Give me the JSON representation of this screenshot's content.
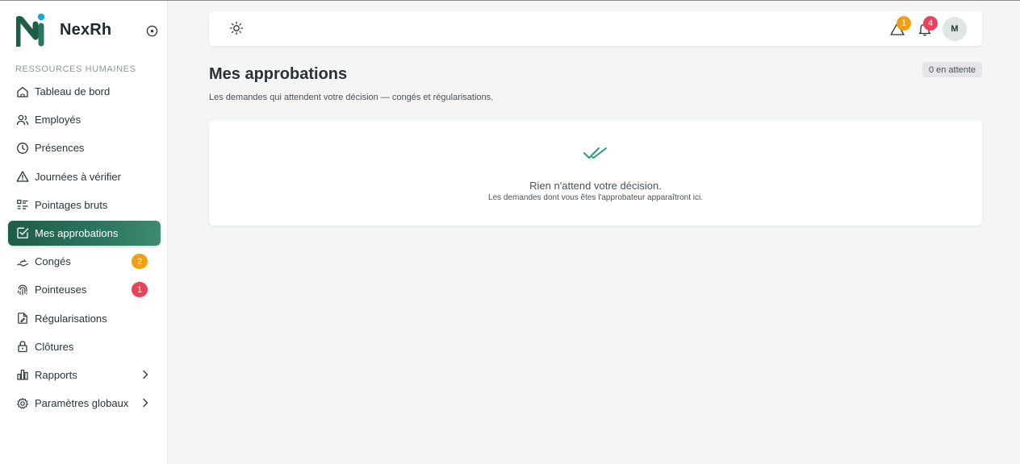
{
  "brand": {
    "name": "NexRh"
  },
  "sidebar": {
    "section_label": "RESSOURCES HUMAINES",
    "items": [
      {
        "label": "Tableau de bord",
        "icon": "home-icon"
      },
      {
        "label": "Employés",
        "icon": "users-icon"
      },
      {
        "label": "Présences",
        "icon": "clock-icon"
      },
      {
        "label": "Journées à vérifier",
        "icon": "warning-icon"
      },
      {
        "label": "Pointages bruts",
        "icon": "list-icon"
      },
      {
        "label": "Mes approbations",
        "icon": "checkbox-icon",
        "active": true
      },
      {
        "label": "Congés",
        "icon": "beach-icon",
        "badge": "2"
      },
      {
        "label": "Pointeuses",
        "icon": "fingerprint-icon",
        "badge": "1"
      },
      {
        "label": "Régularisations",
        "icon": "file-edit-icon"
      },
      {
        "label": "Clôtures",
        "icon": "lock-icon"
      },
      {
        "label": "Rapports",
        "icon": "bar-chart-icon",
        "has_submenu": true
      },
      {
        "label": "Paramètres globaux",
        "icon": "gear-icon",
        "has_submenu": true
      }
    ]
  },
  "topbar": {
    "alerts_count": "1",
    "notifications_count": "4",
    "avatar_initial": "M"
  },
  "page": {
    "title": "Mes approbations",
    "pending": "0 en attente",
    "subtitle": "Les demandes qui attendent votre décision — congés et régularisations.",
    "empty_title": "Rien n'attend votre décision.",
    "empty_subtitle": "Les demandes dont vous êtes l'approbateur apparaîtront ici."
  },
  "colors": {
    "accent": "#2c7560",
    "badge_orange": "#f0a012",
    "badge_red": "#e8425d",
    "logo_blue": "#1aa3e0"
  }
}
